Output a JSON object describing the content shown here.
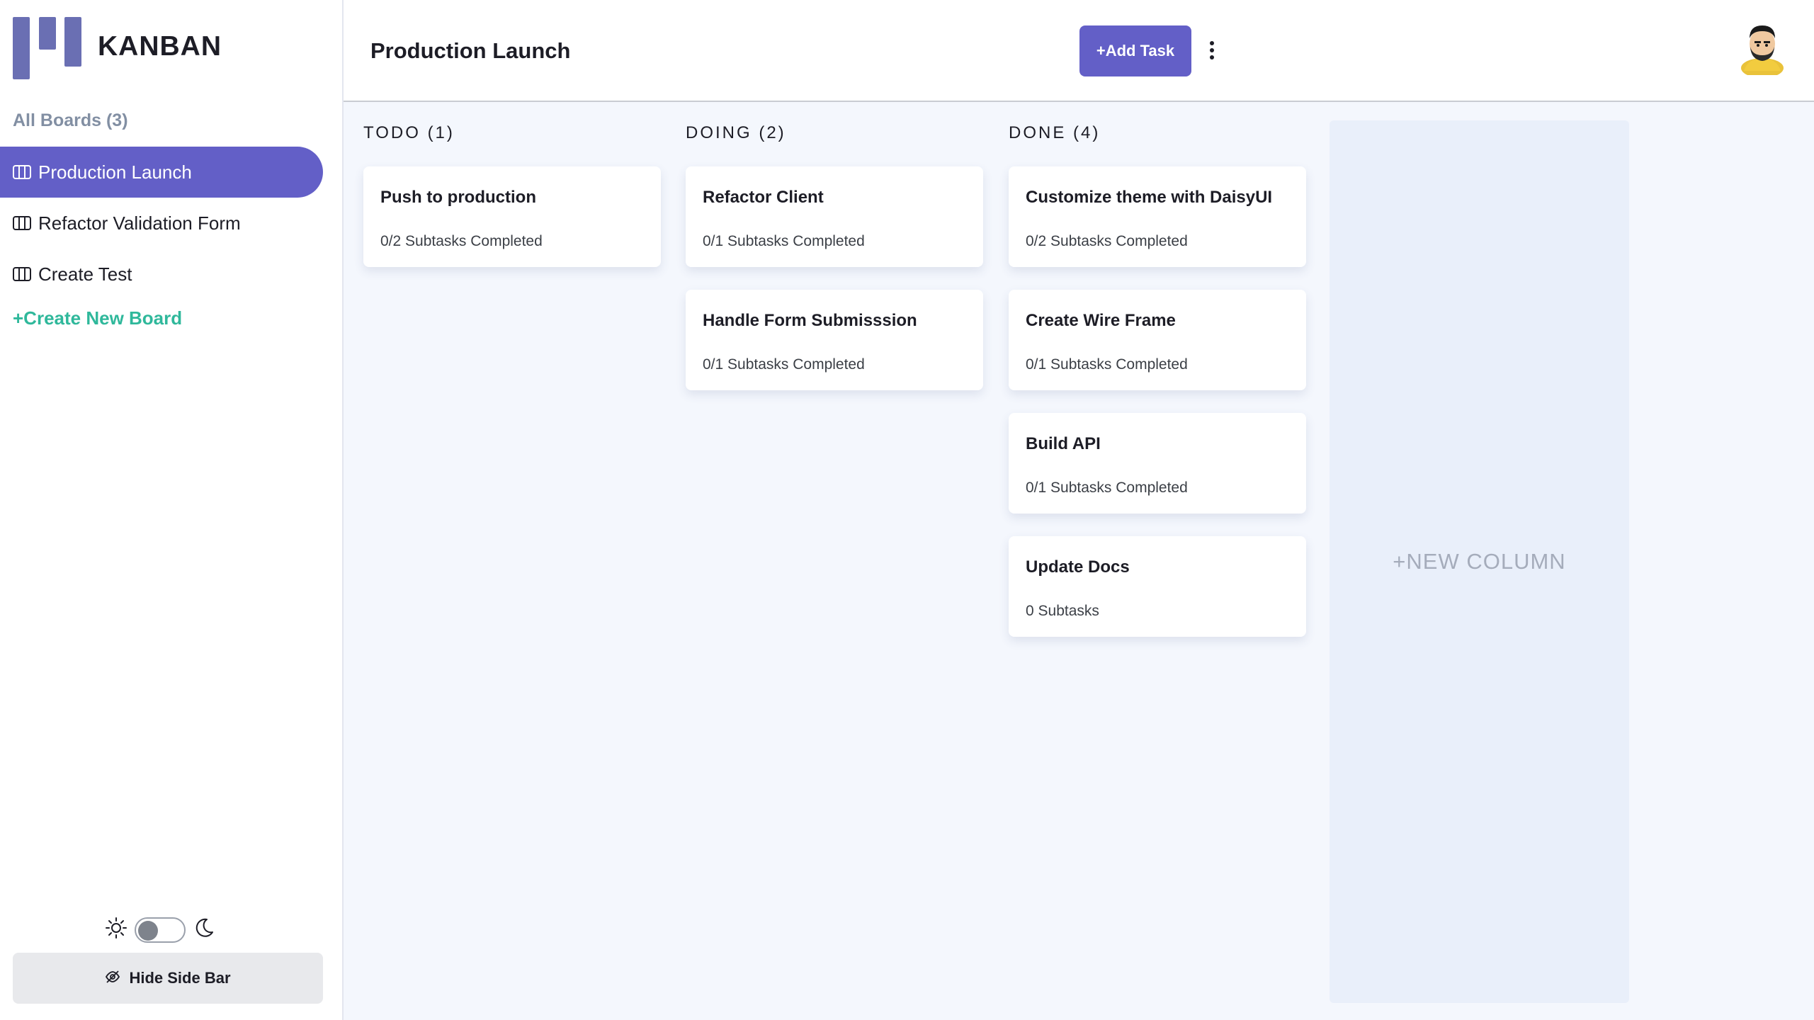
{
  "app": {
    "brand": "KANBAN"
  },
  "sidebar": {
    "all_boards_label": "All Boards (3)",
    "boards": [
      {
        "label": "Production Launch",
        "active": true
      },
      {
        "label": "Refactor Validation Form",
        "active": false
      },
      {
        "label": "Create Test",
        "active": false
      }
    ],
    "create_board_label": "+Create New Board",
    "hide_sidebar_label": "Hide Side Bar",
    "theme": {
      "mode": "light"
    }
  },
  "header": {
    "board_title": "Production Launch",
    "add_task_label": "+Add Task"
  },
  "columns": [
    {
      "heading": "TODO (1)",
      "cards": [
        {
          "title": "Push to production",
          "subtitle": "0/2 Subtasks Completed"
        }
      ]
    },
    {
      "heading": "DOING (2)",
      "cards": [
        {
          "title": "Refactor Client",
          "subtitle": "0/1 Subtasks Completed"
        },
        {
          "title": "Handle Form Submisssion",
          "subtitle": "0/1 Subtasks Completed"
        }
      ]
    },
    {
      "heading": "DONE (4)",
      "cards": [
        {
          "title": "Customize theme with DaisyUI",
          "subtitle": "0/2 Subtasks Completed"
        },
        {
          "title": "Create Wire Frame",
          "subtitle": "0/1 Subtasks Completed"
        },
        {
          "title": "Build API",
          "subtitle": "0/1 Subtasks Completed"
        },
        {
          "title": "Update Docs",
          "subtitle": "0 Subtasks"
        }
      ]
    }
  ],
  "new_column_label": "+NEW COLUMN",
  "colors": {
    "accent": "#635fc7",
    "create_link": "#2fb89b",
    "board_bg": "#f4f7fd"
  }
}
